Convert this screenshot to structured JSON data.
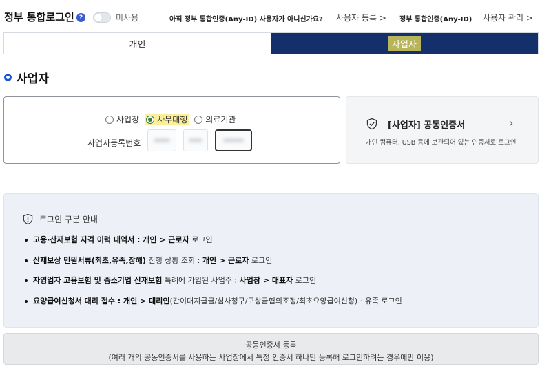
{
  "header": {
    "title": "정부 통합로그인",
    "help_icon": "?",
    "toggle_label": "미사용",
    "anyid_question": "아직 정부 통합인증(Any-ID) 사용자가 아니신가요?",
    "user_register": "사용자 등록 >",
    "anyid_label": "정부 통합인증(Any-ID)",
    "user_manage": "사용자 관리 >"
  },
  "tabs": {
    "personal": "개인",
    "business": "사업자",
    "active": "business"
  },
  "section": {
    "title": "사업자"
  },
  "login": {
    "radios": [
      {
        "label": "사업장",
        "checked": false
      },
      {
        "label": "사무대행",
        "checked": true
      },
      {
        "label": "의료기관",
        "checked": false
      }
    ],
    "bizno_label": "사업자등록번호"
  },
  "cert": {
    "title": "[사업자] 공동인증서",
    "description": "개인 컴퓨터, USB 등에 보관되어 있는 인증서로 로그인",
    "icon": "shield-icon"
  },
  "guide": {
    "title": "로그인 구분 안내",
    "items": [
      {
        "bold1": "고용·산재보험 자격 이력 내역서 : 개인 > 근로자",
        "rest": " 로그인"
      },
      {
        "bold1": "산재보상 민원서류(최초,유족,장해)",
        "mid": " 진행 상황 조회 : ",
        "bold2": "개인 > 근로자",
        "rest": " 로그인"
      },
      {
        "bold1": "자영업자 고용보험 및 중소기업 산재보험",
        "mid": " 특례에 가입된 사업주 : ",
        "bold2": "사업장 > 대표자",
        "rest": " 로그인"
      },
      {
        "bold1": "요양급여신청서 대리 접수 : 개인 > 대리인",
        "rest": "(간이대지급금/심사청구/구상금협의조정/최초요양급여신청) · 유족 로그인"
      }
    ]
  },
  "register": {
    "line1": "공동인증서 등록",
    "line2": "(여러 개의 공동인증서를 사용하는 사업장에서 특정 인증서 하나만 등록해 로그인하려는 경우에만 이용)"
  },
  "colors": {
    "active_tab": "#14306b",
    "tab_highlight": "#b8b45a",
    "accent_blue": "#1c57d3",
    "guide_bg": "#edf1f7"
  }
}
